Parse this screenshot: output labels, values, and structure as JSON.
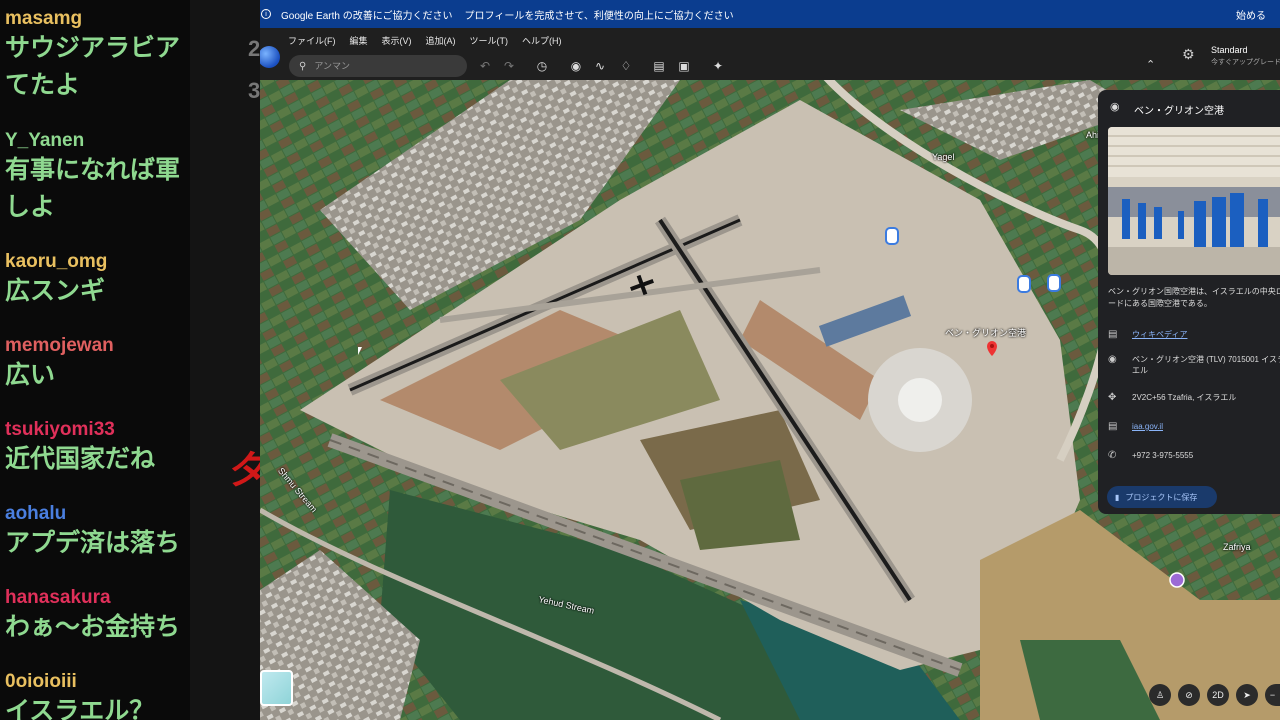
{
  "chat": {
    "messages": [
      {
        "name": "masamg",
        "color": "#e9c060",
        "text": "サウジアラビアてたよ"
      },
      {
        "name": "Y_Yanen",
        "color": "#8fd990",
        "text": "有事になれば軍しよ"
      },
      {
        "name": "kaoru_omg",
        "color": "#e9c060",
        "text": "広スンギ"
      },
      {
        "name": "memojewan",
        "color": "#e06060",
        "text": "広い"
      },
      {
        "name": "tsukiyomi33",
        "color": "#e0305a",
        "text": "近代国家だね"
      },
      {
        "name": "aohalu",
        "color": "#4a7fe0",
        "text": "アプデ済は落ち"
      },
      {
        "name": "hanasakura",
        "color": "#e0305a",
        "text": "わぁ～お金持ち"
      },
      {
        "name": "0oioioiii",
        "color": "#e9c060",
        "text": "イスラエル？"
      }
    ]
  },
  "banner": {
    "app": "Google Earth の改善にご協力ください",
    "message": "プロフィールを完成させて、利便性の向上にご協力ください",
    "start": "始める"
  },
  "menu": [
    "ファイル(F)",
    "編集",
    "表示(V)",
    "追加(A)",
    "ツール(T)",
    "ヘルプ(H)"
  ],
  "search": {
    "placeholder": "アンマン"
  },
  "account": {
    "title": "Standard",
    "subtitle": "今すぐアップグレード"
  },
  "map_labels": {
    "airport": "ベン・グリオン空港",
    "yagel": "Yagel",
    "ahi": "Ahi",
    "zafriya": "Zafriya",
    "yehud_stream": "Yehud Stream",
    "shmu_stream": "Shmu Stream"
  },
  "panel": {
    "title": "ベン・グリオン空港",
    "description": "ベン・グリオン国際空港は、イスラエルの中央ロードにある国際空港である。",
    "wiki": "ウィキペディア",
    "address": "ベン・グリオン空港 (TLV) 7015001 イスラエル",
    "plus_code": "2V2C+56 Tzafria, イスラエル",
    "website": "iaa.gov.il",
    "phone": "+972 3-975-5555",
    "save_button": "プロジェクトに保存"
  },
  "controls": {
    "mode_2d": "2D"
  },
  "icons": {
    "search": "search-icon",
    "undo": "undo-icon",
    "redo": "redo-icon",
    "history": "history-icon",
    "placemark": "placemark-icon",
    "path": "path-icon",
    "layers": "layers-icon",
    "ruler": "ruler-icon",
    "photo": "photo-icon",
    "satellite": "satellite-icon",
    "settings": "gear-icon"
  }
}
